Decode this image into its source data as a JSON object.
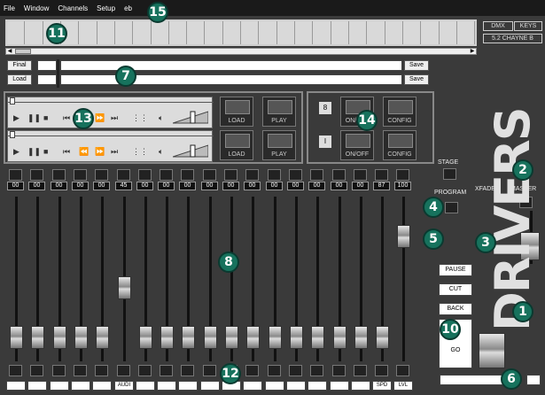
{
  "menu": [
    "File",
    "Window",
    "Channels",
    "Setup",
    "eb"
  ],
  "top_right": {
    "dmx": "DMX",
    "keys": "KEYS",
    "status": "5.2 CHAYNE B"
  },
  "script": {
    "load_label": "Load",
    "save_label": "Save",
    "final_label": "Final",
    "load2_label": "Load",
    "save2_label": "Save"
  },
  "players": [
    {
      "load_label": "LOAD",
      "play_label": "PLAY",
      "volume": 0.6
    },
    {
      "load_label": "LOAD",
      "play_label": "PLAY",
      "volume": 0.6
    }
  ],
  "effects": [
    {
      "number": "8",
      "onoff_label": "ON/OFF",
      "config_label": "CONFIG"
    },
    {
      "number": "I",
      "onoff_label": "ON/OFF",
      "config_label": "CONFIG"
    }
  ],
  "channel_values": [
    "00",
    "00",
    "00",
    "00",
    "00",
    "45",
    "00",
    "00",
    "00",
    "00",
    "00",
    "00",
    "00",
    "00",
    "00",
    "00",
    "00",
    "87",
    "100"
  ],
  "channel_labels": [
    "",
    "",
    "",
    "",
    "",
    "AUDI",
    "",
    "",
    "",
    "",
    "",
    "",
    "",
    "",
    "",
    "",
    "",
    "SPD",
    "LVL"
  ],
  "side": {
    "stage": "STAGE",
    "program": "PROGRAM",
    "xfader": "XFADER",
    "master": "MASTER"
  },
  "buttons": {
    "pause": "PAUSE",
    "cut": "CUT",
    "back": "BACK",
    "go": "GO"
  },
  "brand": "DRIVERS",
  "callouts": [
    "1",
    "2",
    "3",
    "4",
    "5",
    "6",
    "7",
    "8",
    "10",
    "11",
    "12",
    "13",
    "14",
    "15"
  ]
}
